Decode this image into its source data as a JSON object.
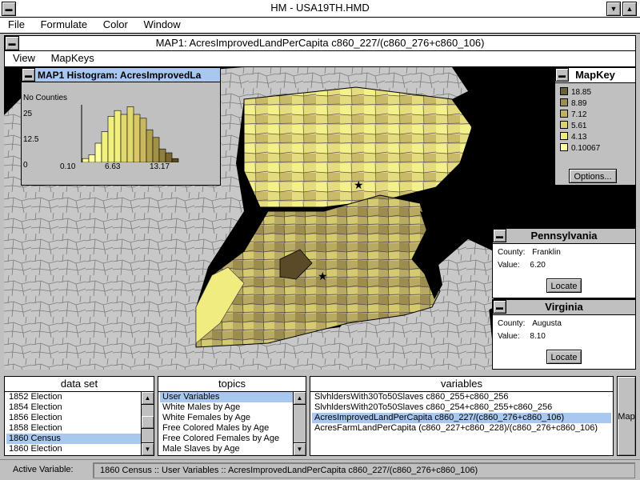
{
  "app": {
    "title": "HM - USA19TH.HMD"
  },
  "menu": {
    "file": "File",
    "formulate": "Formulate",
    "color": "Color",
    "window": "Window"
  },
  "map_window": {
    "title": "MAP1: AcresImprovedLandPerCapita c860_227/(c860_276+c860_106)",
    "menu_view": "View",
    "menu_mapkeys": "MapKeys"
  },
  "histogram": {
    "title": "MAP1 Histogram: AcresImprovedLa",
    "y_label": "No Counties",
    "y_ticks": [
      "25",
      "12.5",
      "0"
    ],
    "x_ticks": [
      "0.10",
      "6.63",
      "13.17"
    ],
    "bins": [
      2,
      4,
      10,
      16,
      24,
      27,
      25,
      29,
      25,
      23,
      17,
      13,
      7,
      5,
      2
    ],
    "colors": [
      "#ffffa0",
      "#ffffa0",
      "#ffffa0",
      "#f0f080",
      "#f0f080",
      "#f0f080",
      "#e0d870",
      "#e0d870",
      "#d8c868",
      "#c8b860",
      "#b0a050",
      "#a09048",
      "#908040",
      "#786830",
      "#5a4a20"
    ]
  },
  "mapkey": {
    "title": "MapKey",
    "entries": [
      {
        "label": "18.85",
        "color": "#6e5e34"
      },
      {
        "label": "8.89",
        "color": "#9c8c4e"
      },
      {
        "label": "7.12",
        "color": "#c0b060"
      },
      {
        "label": "5.61",
        "color": "#dcd070"
      },
      {
        "label": "4.13",
        "color": "#f0ec80"
      },
      {
        "label": "0.10067",
        "color": "#ffffa0"
      }
    ],
    "options_label": "Options..."
  },
  "info_pa": {
    "title": "Pennsylvania",
    "county_label": "County:",
    "county": "Franklin",
    "value_label": "Value:",
    "value": "6.20",
    "locate": "Locate"
  },
  "info_va": {
    "title": "Virginia",
    "county_label": "County:",
    "county": "Augusta",
    "value_label": "Value:",
    "value": "8.10",
    "locate": "Locate"
  },
  "dataset": {
    "title": "data set",
    "items": [
      "1852 Election",
      "1854 Election",
      "1856 Election",
      "1858 Election",
      "1860 Census",
      "1860 Election"
    ],
    "selected": 4
  },
  "topics": {
    "title": "topics",
    "items": [
      "User Variables",
      "White Males by Age",
      "White Females by Age",
      "Free Colored Males by Age",
      "Free Colored Females by Age",
      "Male Slaves by Age"
    ],
    "selected": 0
  },
  "variables": {
    "title": "variables",
    "items": [
      "SlvhldersWith30To50Slaves c860_255+c860_256",
      "SlvhldersWith20To50Slaves c860_254+c860_255+c860_256",
      "AcresImprovedLandPerCapita c860_227/(c860_276+c860_106)",
      "AcresFarmLandPerCapita (c860_227+c860_228)/(c860_276+c860_106)"
    ],
    "selected": 2
  },
  "map_button": "Map",
  "status": {
    "label": "Active Variable:",
    "value": "1860 Census :: User Variables :: AcresImprovedLandPerCapita c860_227/(c860_276+c860_106)"
  }
}
